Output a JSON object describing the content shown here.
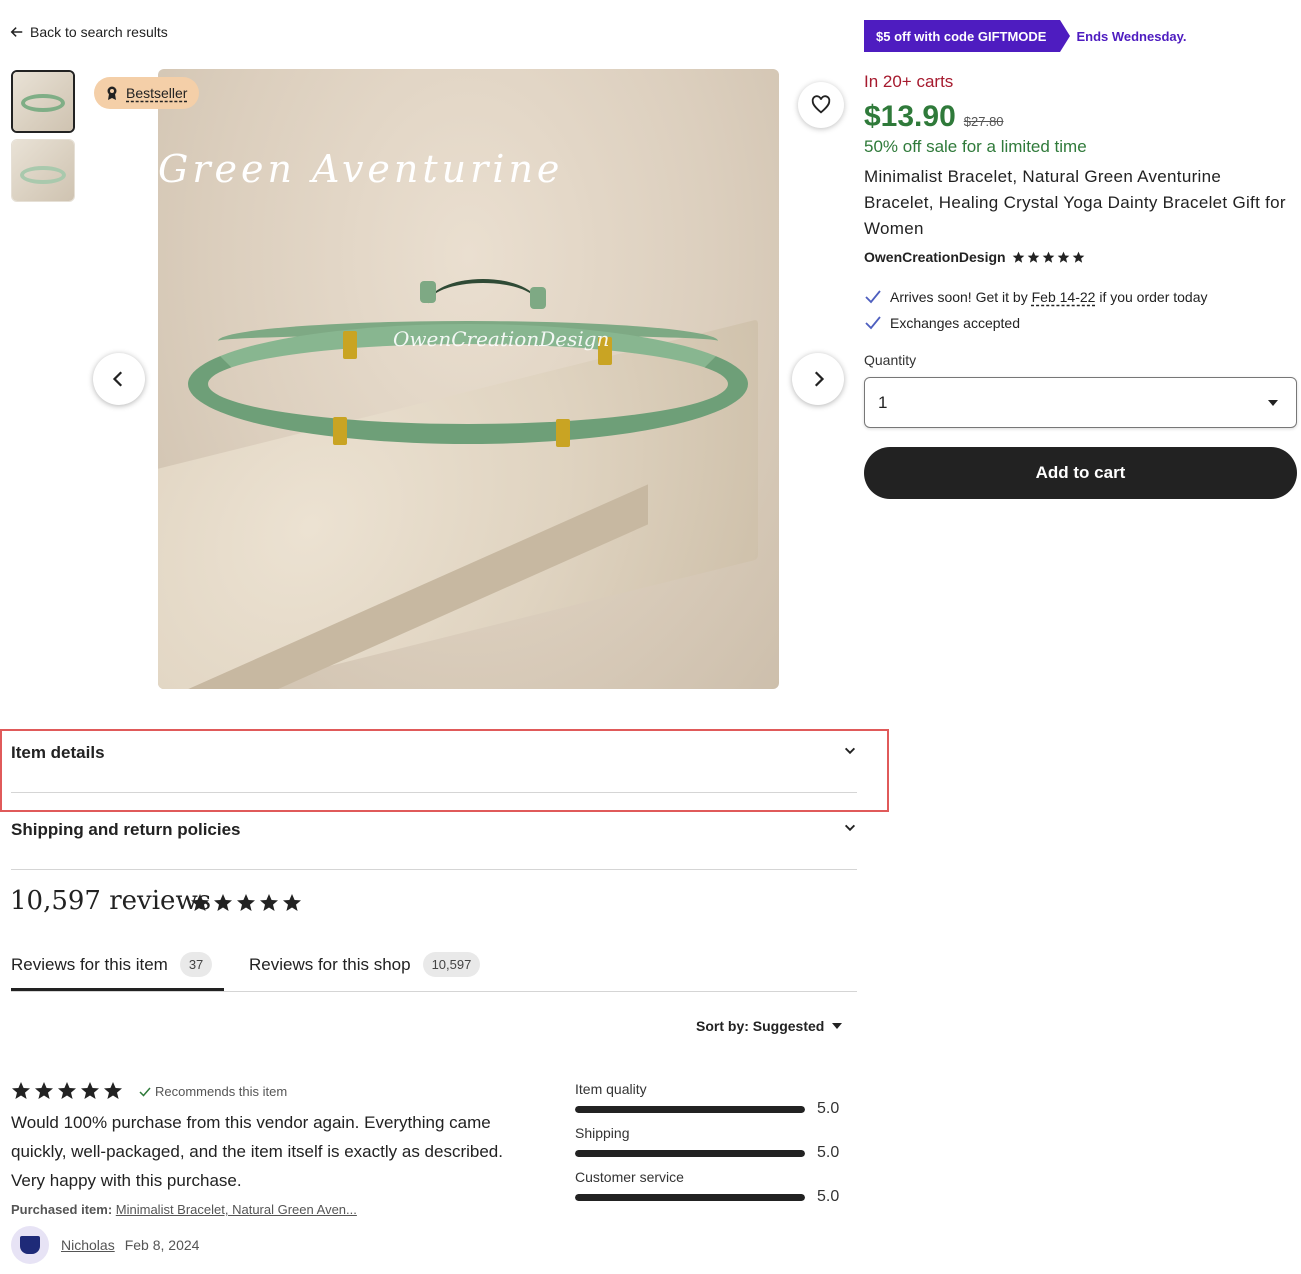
{
  "nav": {
    "back_label": "Back to search results"
  },
  "gallery": {
    "badge_label": "Bestseller",
    "watermark_title": "Green Aventurine",
    "watermark_brand": "OwenCreationDesign"
  },
  "promo": {
    "code_label": "$5 off with code GIFTMODE",
    "ends_label": "Ends Wednesday."
  },
  "product": {
    "in_carts": "In 20+ carts",
    "price": "$13.90",
    "original_price": "$27.80",
    "sale_note": "50% off sale for a limited time",
    "title": "Minimalist Bracelet, Natural Green Aventurine Bracelet, Healing Crystal Yoga Dainty Bracelet Gift for Women",
    "shop_name": "OwenCreationDesign",
    "shop_rating": 5
  },
  "perks": {
    "arrives_prefix": "Arrives soon! Get it by ",
    "arrives_dates": "Feb 14-22",
    "arrives_suffix": " if you order today",
    "exchanges": "Exchanges accepted"
  },
  "quantity": {
    "label": "Quantity",
    "selected": "1"
  },
  "cart": {
    "button_label": "Add to cart"
  },
  "accordions": {
    "item_details": "Item details",
    "shipping": "Shipping and return policies"
  },
  "reviews": {
    "count_label": "10,597 reviews",
    "overall_rating": 5,
    "tabs": [
      {
        "label": "Reviews for this item",
        "count": "37"
      },
      {
        "label": "Reviews for this shop",
        "count": "10,597"
      }
    ],
    "sort_label": "Sort by: Suggested",
    "first_review": {
      "rating": 5,
      "recommends": "Recommends this item",
      "text": "Would 100% purchase from this vendor again. Everything came quickly, well-packaged, and the item itself is exactly as described. Very happy with this purchase.",
      "purchased_label": "Purchased item:",
      "purchased_item": "Minimalist Bracelet, Natural Green Aven...",
      "reviewer": "Nicholas",
      "date": "Feb 8, 2024"
    },
    "ratings": [
      {
        "label": "Item quality",
        "value": "5.0",
        "fraction": 1.0
      },
      {
        "label": "Shipping",
        "value": "5.0",
        "fraction": 1.0
      },
      {
        "label": "Customer service",
        "value": "5.0",
        "fraction": 1.0
      }
    ]
  },
  "colors": {
    "price_green": "#2f7a3a",
    "promo_purple": "#4e1cc0",
    "carts_red": "#a61a2e",
    "highlight_red": "#e05a5a",
    "check_blue": "#4e5fbf"
  },
  "icons": {
    "back": "arrow-left-icon",
    "favorite": "heart-icon",
    "prev": "chevron-left-icon",
    "next": "chevron-right-icon",
    "badge": "award-icon",
    "perk": "check-icon",
    "accordion": "chevron-down-icon",
    "star": "star-icon"
  }
}
